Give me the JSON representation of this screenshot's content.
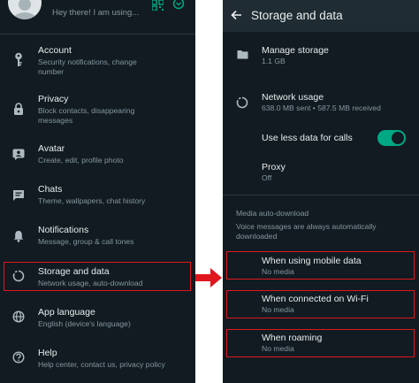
{
  "colors": {
    "panel_bg": "#111b21",
    "divider": "#2a3942",
    "accent": "#00a884",
    "highlight": "#e0161e",
    "text_primary": "#e9edef",
    "text_secondary": "#8696a0"
  },
  "left": {
    "profile": {
      "status": "Hey there! I am using..."
    },
    "items": [
      {
        "icon": "key-icon",
        "title": "Account",
        "subtitle": "Security notifications, change number"
      },
      {
        "icon": "lock-icon",
        "title": "Privacy",
        "subtitle": "Block contacts, disappearing messages"
      },
      {
        "icon": "avatar-icon",
        "title": "Avatar",
        "subtitle": "Create, edit, profile photo"
      },
      {
        "icon": "chat-icon",
        "title": "Chats",
        "subtitle": "Theme, wallpapers, chat history"
      },
      {
        "icon": "bell-icon",
        "title": "Notifications",
        "subtitle": "Message, group & call tones"
      },
      {
        "icon": "data-usage-icon",
        "title": "Storage and data",
        "subtitle": "Network usage, auto-download"
      },
      {
        "icon": "globe-icon",
        "title": "App language",
        "subtitle": "English (device's language)"
      },
      {
        "icon": "help-icon",
        "title": "Help",
        "subtitle": "Help center, contact us, privacy policy"
      }
    ]
  },
  "right": {
    "header": {
      "title": "Storage and data"
    },
    "manage_storage": {
      "title": "Manage storage",
      "subtitle": "1.1 GB"
    },
    "network_usage": {
      "title": "Network usage",
      "subtitle": "638.0 MB sent • 587.5 MB received"
    },
    "less_data": {
      "title": "Use less data for calls",
      "enabled": true
    },
    "proxy": {
      "title": "Proxy",
      "subtitle": "Off"
    },
    "auto_download": {
      "section_title": "Media auto-download",
      "note": "Voice messages are always automatically downloaded",
      "options": [
        {
          "title": "When using mobile data",
          "subtitle": "No media"
        },
        {
          "title": "When connected on Wi-Fi",
          "subtitle": "No media"
        },
        {
          "title": "When roaming",
          "subtitle": "No media"
        }
      ]
    }
  }
}
